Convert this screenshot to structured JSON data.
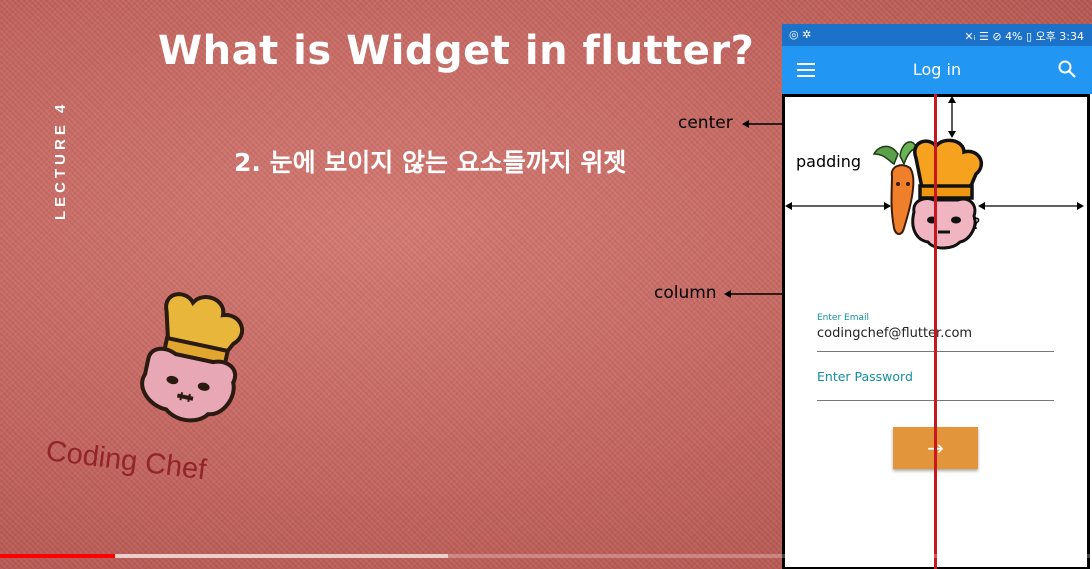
{
  "slide": {
    "title": "What is Widget in flutter?",
    "subtitle": "2.  눈에 보이지 않는 요소들까지 위젯",
    "lecture_label": "LECTURE 4",
    "brand_name": "Coding Chef"
  },
  "phone": {
    "status_left": "◎ ✲",
    "status_right": "✕ᵢ ☰ ⊘ 4% ▯ 오후 3:34",
    "appbar_title": "Log in",
    "email_label": "Enter Email",
    "email_value": "codingchef@flutter.com",
    "password_placeholder": "Enter Password",
    "submit_icon": "→",
    "icons": {
      "menu": "menu-icon",
      "search": "search-icon"
    }
  },
  "annotations": {
    "center": "center",
    "padding": "padding",
    "column": "column",
    "question": "?"
  },
  "player": {
    "played_fraction": 0.105,
    "buffered_fraction": 0.41
  },
  "colors": {
    "background": "#c4645e",
    "appbar": "#2196f3",
    "statusbar": "#1c72c8",
    "button": "#e2953a",
    "guide_line": "#c8181e",
    "progress_played": "#ff0000"
  }
}
